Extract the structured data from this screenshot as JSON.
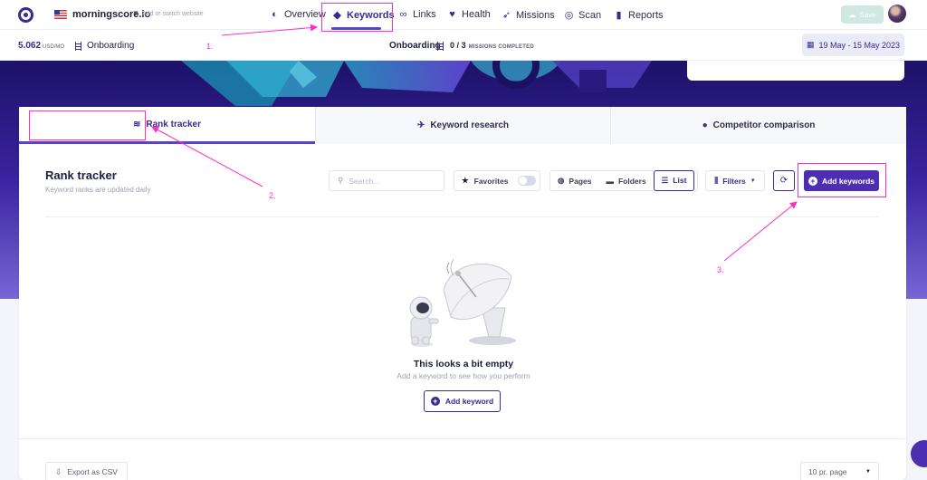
{
  "topnav": {
    "site": "morningscore.io",
    "site_hint": "Add or switch website",
    "items": [
      {
        "label": "Overview",
        "icon": "planet-icon"
      },
      {
        "label": "Keywords",
        "icon": "tag-icon",
        "active": true
      },
      {
        "label": "Links",
        "icon": "link-icon"
      },
      {
        "label": "Health",
        "icon": "heart-icon"
      },
      {
        "label": "Missions",
        "icon": "rocket-icon"
      },
      {
        "label": "Scan",
        "icon": "radar-icon"
      },
      {
        "label": "Reports",
        "icon": "bookmark-icon"
      }
    ],
    "save_label": "Save"
  },
  "subbar": {
    "score": "5.062",
    "score_unit": "USD/MO",
    "onboarding_left": "Onboarding",
    "onboarding_center": "Onboarding",
    "missions_done": "0",
    "missions_sep": "/",
    "missions_total": "3",
    "missions_label": "MISSIONS COMPLETED",
    "date_range": "19 May - 15 May 2023"
  },
  "tabs": [
    {
      "label": "Rank tracker",
      "icon": "layers-icon",
      "active": true
    },
    {
      "label": "Keyword research",
      "icon": "telescope-icon"
    },
    {
      "label": "Competitor comparison",
      "icon": "alien-icon"
    }
  ],
  "main": {
    "title": "Rank tracker",
    "subtitle": "Keyword ranks are updated daily",
    "search_placeholder": "Search...",
    "favorites_label": "Favorites",
    "view_pages": "Pages",
    "view_folders": "Folders",
    "view_list": "List",
    "filters_label": "Filters",
    "add_keywords_label": "Add keywords",
    "empty_title": "This looks a bit empty",
    "empty_sub": "Add a keyword to see how you perform",
    "add_keyword_label": "Add keyword",
    "export_label": "Export as CSV",
    "per_page": "10 pr. page"
  },
  "annotations": {
    "n1": "1.",
    "n2": "2.",
    "n3": "3."
  },
  "colors": {
    "accent": "#4b2fb0",
    "annotation": "#ff2fc3",
    "hero_top": "#25157a"
  }
}
